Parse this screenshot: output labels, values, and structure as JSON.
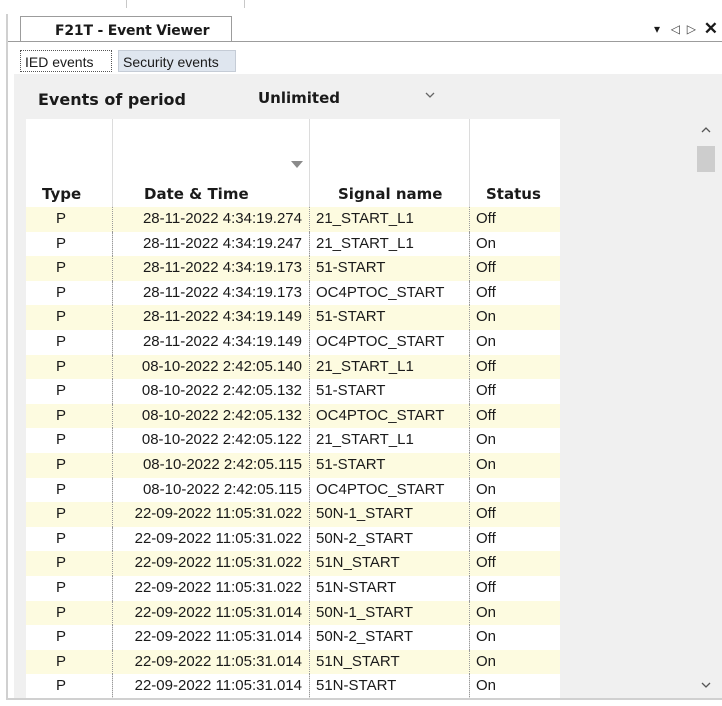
{
  "window": {
    "title": "F21T - Event Viewer",
    "controls": {
      "menu": "▾",
      "prev": "◁",
      "next": "▷",
      "close": "✕"
    }
  },
  "tabs": [
    {
      "label": "IED events",
      "active": true
    },
    {
      "label": "Security events",
      "active": false
    }
  ],
  "filter": {
    "label": "Events of period",
    "selected": "Unlimited"
  },
  "table": {
    "columns": [
      "Type",
      "Date & Time",
      "Signal name",
      "Status"
    ],
    "sort_column": "Date & Time",
    "rows": [
      {
        "type": "P",
        "datetime": "28-11-2022  4:34:19.274",
        "signal": "21_START_L1",
        "status": "Off"
      },
      {
        "type": "P",
        "datetime": "28-11-2022  4:34:19.247",
        "signal": "21_START_L1",
        "status": "On"
      },
      {
        "type": "P",
        "datetime": "28-11-2022  4:34:19.173",
        "signal": "51-START",
        "status": "Off"
      },
      {
        "type": "P",
        "datetime": "28-11-2022  4:34:19.173",
        "signal": "OC4PTOC_START",
        "status": "Off"
      },
      {
        "type": "P",
        "datetime": "28-11-2022  4:34:19.149",
        "signal": "51-START",
        "status": "On"
      },
      {
        "type": "P",
        "datetime": "28-11-2022  4:34:19.149",
        "signal": "OC4PTOC_START",
        "status": "On"
      },
      {
        "type": "P",
        "datetime": "08-10-2022  2:42:05.140",
        "signal": "21_START_L1",
        "status": "Off"
      },
      {
        "type": "P",
        "datetime": "08-10-2022  2:42:05.132",
        "signal": "51-START",
        "status": "Off"
      },
      {
        "type": "P",
        "datetime": "08-10-2022  2:42:05.132",
        "signal": "OC4PTOC_START",
        "status": "Off"
      },
      {
        "type": "P",
        "datetime": "08-10-2022  2:42:05.122",
        "signal": "21_START_L1",
        "status": "On"
      },
      {
        "type": "P",
        "datetime": "08-10-2022  2:42:05.115",
        "signal": "51-START",
        "status": "On"
      },
      {
        "type": "P",
        "datetime": "08-10-2022  2:42:05.115",
        "signal": "OC4PTOC_START",
        "status": "On"
      },
      {
        "type": "P",
        "datetime": "22-09-2022  11:05:31.022",
        "signal": "50N-1_START",
        "status": "Off"
      },
      {
        "type": "P",
        "datetime": "22-09-2022  11:05:31.022",
        "signal": "50N-2_START",
        "status": "Off"
      },
      {
        "type": "P",
        "datetime": "22-09-2022  11:05:31.022",
        "signal": "51N_START",
        "status": "Off"
      },
      {
        "type": "P",
        "datetime": "22-09-2022  11:05:31.022",
        "signal": "51N-START",
        "status": "Off"
      },
      {
        "type": "P",
        "datetime": "22-09-2022  11:05:31.014",
        "signal": "50N-1_START",
        "status": "On"
      },
      {
        "type": "P",
        "datetime": "22-09-2022  11:05:31.014",
        "signal": "50N-2_START",
        "status": "On"
      },
      {
        "type": "P",
        "datetime": "22-09-2022  11:05:31.014",
        "signal": "51N_START",
        "status": "On"
      },
      {
        "type": "P",
        "datetime": "22-09-2022  11:05:31.014",
        "signal": "51N-START",
        "status": "On"
      }
    ]
  },
  "icons": {
    "select_chevron": "chevron-down-icon",
    "sort_indicator": "sort-descending-icon",
    "scroll_up": "scroll-up-icon",
    "scroll_down": "scroll-down-icon"
  },
  "colors": {
    "highlight_row": "#fdfbe0",
    "panel_bg": "#f0f0f0",
    "inactive_tab": "#dfe6ef"
  }
}
